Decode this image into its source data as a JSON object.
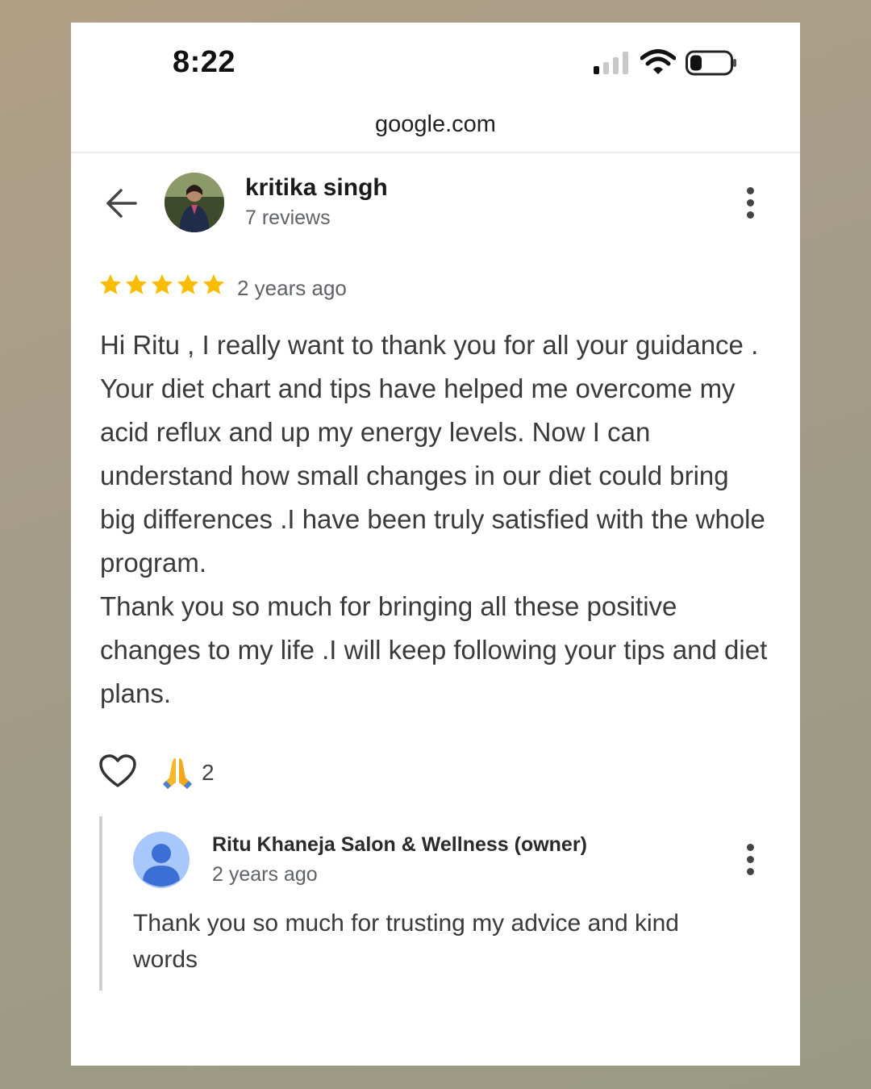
{
  "status_bar": {
    "time": "8:22",
    "signal_icon": "cellular-signal-icon",
    "wifi_icon": "wifi-icon",
    "battery_icon": "battery-icon",
    "battery_level": 0.25
  },
  "browser": {
    "url": "google.com"
  },
  "review": {
    "back_icon": "back-arrow-icon",
    "reviewer_name": "kritika singh",
    "reviewer_meta": "7 reviews",
    "menu_icon": "more-vert-icon",
    "rating": 5,
    "rating_max": 5,
    "star_color": "#fbbc04",
    "time_ago": "2 years ago",
    "text": "Hi Ritu , I really want to thank you for all your guidance . Your diet chart and tips have helped me overcome my acid reflux and up my energy levels. Now I can understand how small changes in our diet could bring big differences .I have been truly satisfied with the whole program.\nThank you so much for bringing all these positive changes to my life .I will keep following your tips and diet plans."
  },
  "reactions": {
    "like_icon": "heart-outline-icon",
    "emoji_icon": "folded-hands-icon",
    "count": "2"
  },
  "owner_reply": {
    "avatar_icon": "person-avatar-icon",
    "owner_name": "Ritu Khaneja Salon & Wellness (owner)",
    "time_ago": "2 years ago",
    "menu_icon": "more-vert-icon",
    "text": "Thank you so much for trusting my advice and kind words"
  }
}
